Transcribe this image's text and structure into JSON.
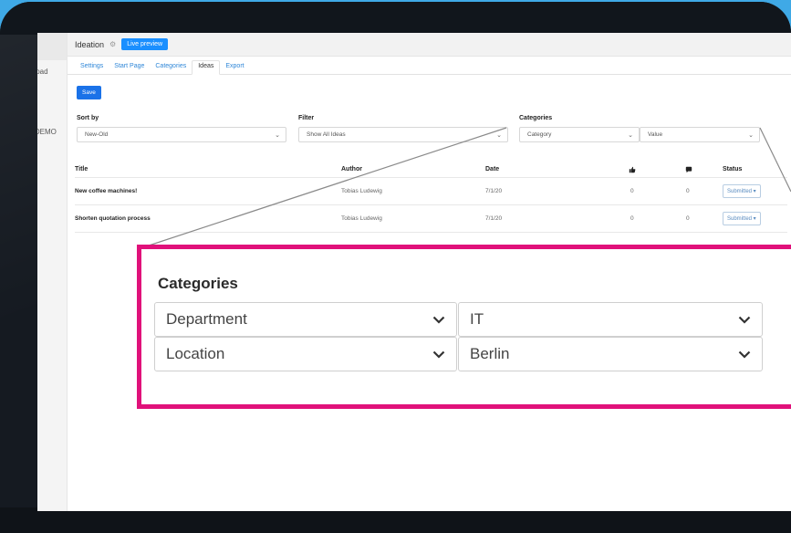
{
  "sidebar": {
    "items": [
      {
        "label": "nload"
      },
      {
        "label": "- DEMO"
      }
    ]
  },
  "header": {
    "title": "Ideation",
    "live_preview_label": "Live preview"
  },
  "tabs": [
    {
      "label": "Settings"
    },
    {
      "label": "Start Page"
    },
    {
      "label": "Categories"
    },
    {
      "label": "Ideas"
    },
    {
      "label": "Export"
    }
  ],
  "toolbar": {
    "save_label": "Save"
  },
  "filters": {
    "sort_label": "Sort by",
    "sort_value": "New-Old",
    "filter_label": "Filter",
    "filter_value": "Show All Ideas",
    "categories_label": "Categories",
    "category_value": "Category",
    "value_value": "Value"
  },
  "table": {
    "columns": {
      "title": "Title",
      "author": "Author",
      "date": "Date",
      "likes_icon": "thumbs-up-icon",
      "comments_icon": "comment-icon",
      "status": "Status"
    },
    "rows": [
      {
        "title": "New coffee machines!",
        "author": "Tobias Ludewig",
        "date": "7/1/20",
        "likes": "0",
        "comments": "0",
        "status": "Submitted ▾"
      },
      {
        "title": "Shorten quotation process",
        "author": "Tobias Ludewig",
        "date": "7/1/20",
        "likes": "0",
        "comments": "0",
        "status": "Submitted ▾"
      }
    ]
  },
  "callout": {
    "title": "Categories",
    "rows": [
      {
        "category": "Department",
        "value": "IT"
      },
      {
        "category": "Location",
        "value": "Berlin"
      }
    ],
    "border_color": "#e0117a"
  },
  "colors": {
    "background": "#3fa9e6",
    "accent": "#1a8fff",
    "highlight": "#e0117a"
  }
}
